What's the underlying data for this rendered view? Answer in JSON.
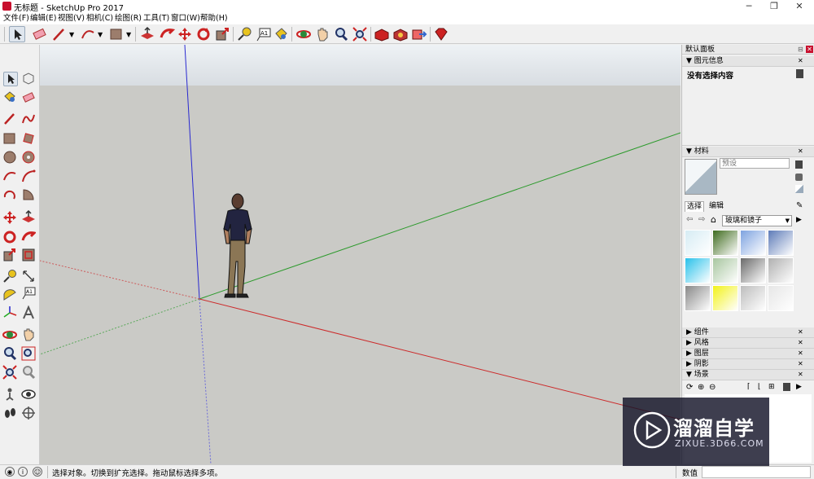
{
  "window": {
    "title": "无标题 - SketchUp Pro 2017",
    "controls": [
      "─",
      "❐",
      "✕"
    ]
  },
  "menu": [
    "文件(F)",
    "编辑(E)",
    "视图(V)",
    "相机(C)",
    "绘图(R)",
    "工具(T)",
    "窗口(W)",
    "帮助(H)"
  ],
  "panel": {
    "title": "默认面板",
    "entity_info": {
      "header": "图元信息",
      "text": "没有选择内容"
    },
    "materials": {
      "header": "材料",
      "preset_placeholder": "预设",
      "tabs": [
        "选择",
        "编辑"
      ],
      "library": "玻璃和镜子",
      "tile_colors": [
        "#d6ecf4",
        "#3f6b1e",
        "#7ea3e0",
        "#5d7bb8",
        "#29c1ea",
        "#a8c6a0",
        "#6a6a6a",
        "#b0b0b0",
        "#888888",
        "#f2f21a",
        "#bdbdbd",
        "#e6e6e6"
      ]
    },
    "collapsed_sections": [
      "组件",
      "风格",
      "图层",
      "阴影"
    ],
    "scenes": {
      "header": "场景"
    }
  },
  "status": {
    "message": "选择对象。切换到扩充选择。拖动鼠标选择多项。",
    "measure_label": "数值"
  },
  "watermark": {
    "brand": "溜溜自学",
    "url": "ZIXUE.3D66.COM"
  },
  "colors": {
    "accent": "#c8102e",
    "axis_red": "#cc2222",
    "axis_green": "#22aa22",
    "axis_blue": "#2222cc"
  }
}
